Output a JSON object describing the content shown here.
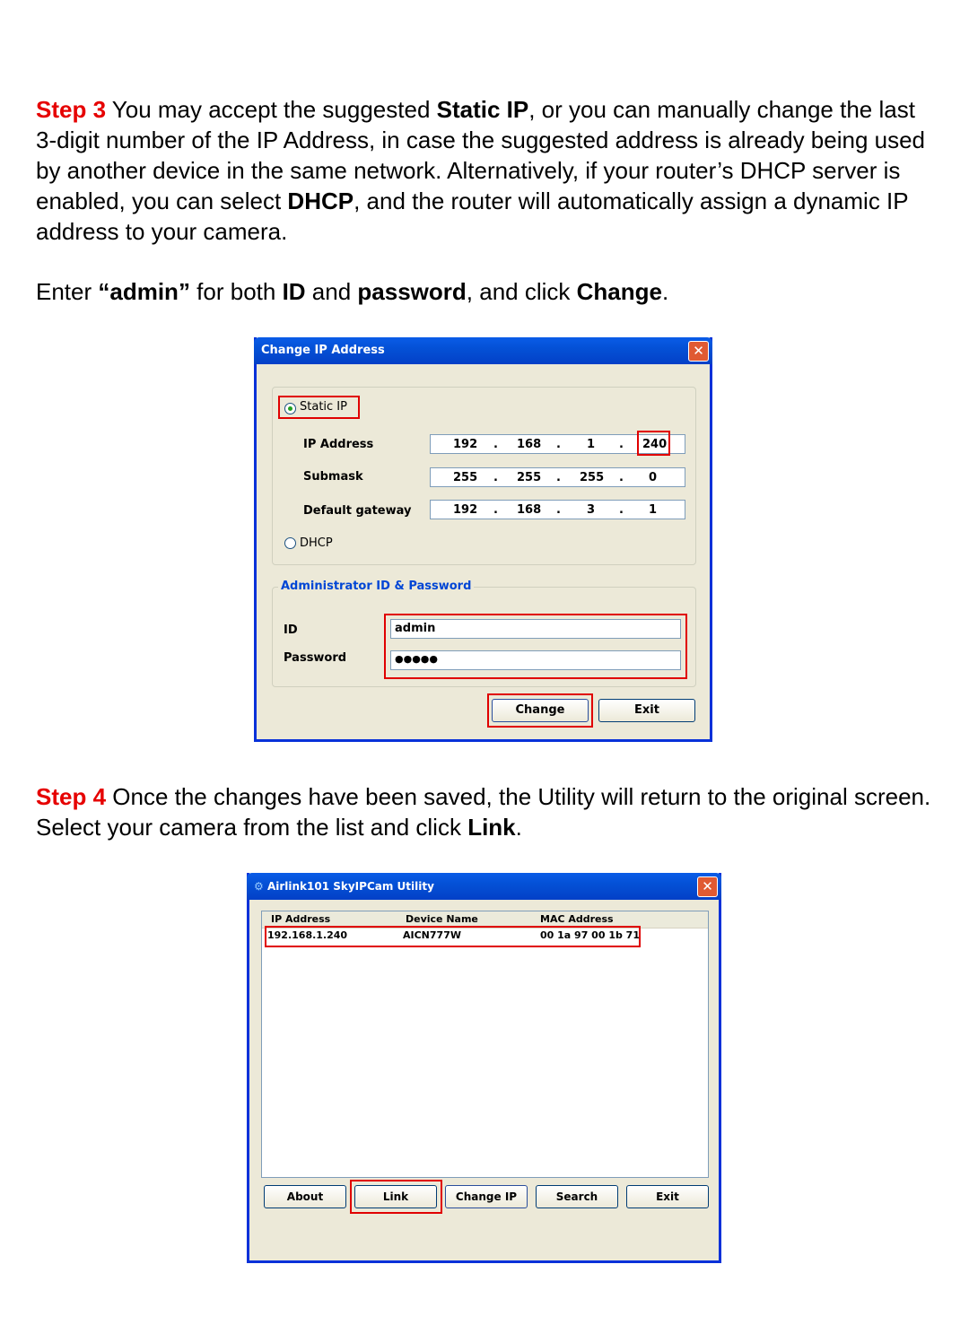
{
  "step3": {
    "label": "Step 3",
    "t1": " You may accept the suggested ",
    "b1": "Static IP",
    "t2": ", or you can manually change the last 3-digit number of the IP Address, in case the suggested address is already being used by another device in the same network. Alternatively, if your router’s DHCP server is enabled, you can select ",
    "b2": "DHCP",
    "t3": ", and the router will automatically assign a dynamic IP address to your camera."
  },
  "instruction": {
    "t1": "Enter ",
    "b1": "“admin”",
    "t2": " for both ",
    "b2": "ID",
    "t3": " and ",
    "b3": "password",
    "t4": ", and click ",
    "b4": "Change",
    "t5": "."
  },
  "change_ip_dialog": {
    "title": "Change IP Address",
    "close": "✕",
    "static_ip_label": "Static IP",
    "static_ip_selected": true,
    "ip_label": "IP Address",
    "ip": [
      "192",
      "168",
      "1",
      "240"
    ],
    "submask_label": "Submask",
    "submask": [
      "255",
      "255",
      "255",
      "0"
    ],
    "gateway_label": "Default gateway",
    "gateway": [
      "192",
      "168",
      "3",
      "1"
    ],
    "dhcp_label": "DHCP",
    "admin_group_label": "Administrator ID & Password",
    "id_label": "ID",
    "id_value": "admin",
    "password_label": "Password",
    "password_value": "●●●●●",
    "change_button": "Change",
    "exit_button": "Exit",
    "dot": "."
  },
  "step4": {
    "label": "Step 4",
    "t1": " Once the changes have been saved, the Utility will return to the original screen.  Select your camera from the list and click ",
    "b1": "Link",
    "t2": "."
  },
  "utility_window": {
    "title": "Airlink101 SkyIPCam Utility",
    "close": "✕",
    "columns": [
      "IP Address",
      "Device Name",
      "MAC Address"
    ],
    "rows": [
      [
        "192.168.1.240",
        "AICN777W",
        "00 1a 97 00 1b 71"
      ]
    ],
    "buttons": [
      "About",
      "Link",
      "Change IP",
      "Search",
      "Exit"
    ]
  }
}
